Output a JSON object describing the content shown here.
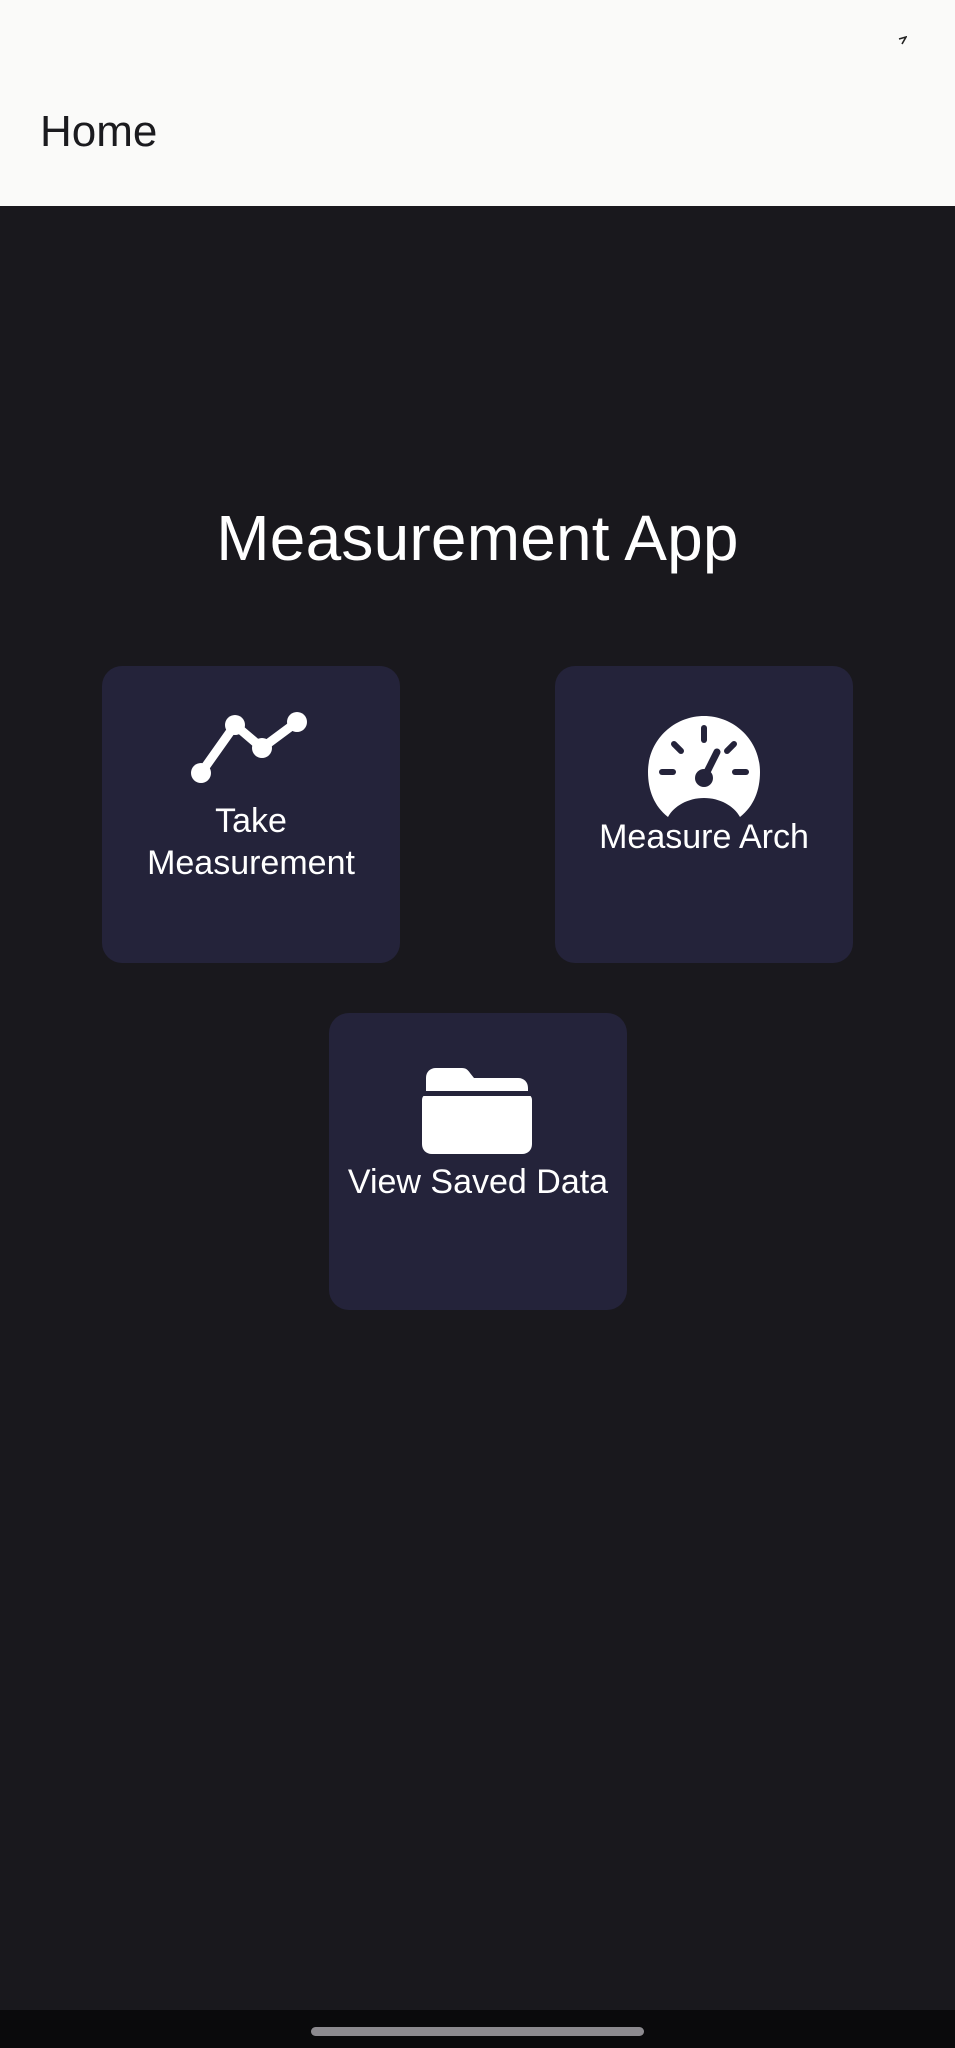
{
  "app_bar": {
    "title": "Home"
  },
  "main": {
    "title": "Measurement App",
    "tiles": [
      {
        "label": "Take\nMeasurement",
        "icon": "line-chart-icon"
      },
      {
        "label": "Measure Arch",
        "icon": "gauge-icon"
      },
      {
        "label": "View Saved Data",
        "icon": "folder-icon"
      }
    ]
  },
  "colors": {
    "app_bar_background": "#fafaf9",
    "content_background": "#19181d",
    "tile_background": "#24233a",
    "text_primary": "#ffffff",
    "app_bar_text": "#1b1b1f"
  }
}
